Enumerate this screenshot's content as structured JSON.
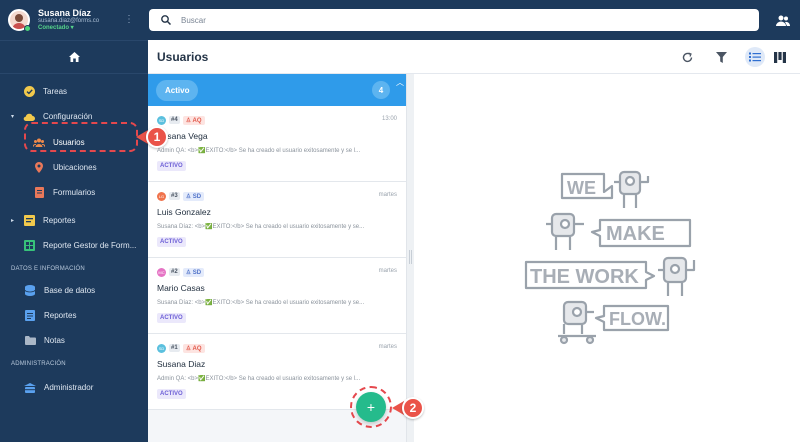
{
  "user": {
    "name": "Susana Díaz",
    "email": "susana.diaz@forms.co",
    "status": "Conectado"
  },
  "search": {
    "placeholder": "Buscar"
  },
  "sidebar": {
    "items": [
      {
        "label": "Tareas"
      },
      {
        "label": "Configuración"
      },
      {
        "label": "Usuarios"
      },
      {
        "label": "Ubicaciones"
      },
      {
        "label": "Formularios"
      },
      {
        "label": "Reportes"
      },
      {
        "label": "Reporte Gestor de Form..."
      }
    ],
    "section_data": "DATOS E INFORMACIÓN",
    "data_items": [
      {
        "label": "Base de datos"
      },
      {
        "label": "Reportes"
      },
      {
        "label": "Notas"
      }
    ],
    "section_admin": "ADMINISTRACIÓN",
    "admin_items": [
      {
        "label": "Administrador"
      }
    ]
  },
  "main": {
    "title": "Usuarios",
    "status_label": "Activo",
    "status_count": "4",
    "cards": [
      {
        "initials": "SD",
        "number": "#4",
        "assignee": "AQ",
        "time": "13:00",
        "name": "Susana Vega",
        "message": "Admin QA: <b>✅ÉXITO:</b> Se ha creado el usuario exitosamente y se l...",
        "badge": "ACTIVO"
      },
      {
        "initials": "LG",
        "number": "#3",
        "assignee": "SD",
        "time": "martes",
        "name": "Luis Gonzalez",
        "message": "Susana Díaz: <b>✅ÉXITO:</b> Se ha creado el usuario exitosamente y se...",
        "badge": "ACTIVO"
      },
      {
        "initials": "MC",
        "number": "#2",
        "assignee": "SD",
        "time": "martes",
        "name": "Mario Casas",
        "message": "Susana Díaz: <b>✅ÉXITO:</b> Se ha creado el usuario exitosamente y se...",
        "badge": "ACTIVO"
      },
      {
        "initials": "SD",
        "number": "#1",
        "assignee": "AQ",
        "time": "martes",
        "name": "Susana Diaz",
        "message": "Admin QA: <b>✅ÉXITO:</b> Se ha creado el usuario exitosamente y se l...",
        "badge": "ACTIVO"
      }
    ]
  },
  "illustration": {
    "line1": "WE",
    "line2": "MAKE",
    "line3": "THE WORK",
    "line4": "FLOW."
  },
  "callouts": {
    "one": "1",
    "two": "2"
  },
  "fab_label": "+",
  "colors": {
    "sidebar": "#1d3a5c",
    "accent": "#2f9bea",
    "fab": "#25bb8c",
    "callout": "#ea5349",
    "badge": "#6d5fd6"
  },
  "icons": [
    "home-icon",
    "check-circle-icon",
    "cloud-icon",
    "users-icon",
    "map-pin-icon",
    "form-icon",
    "report-icon",
    "database-icon",
    "notes-icon",
    "folder-icon",
    "admin-icon",
    "search-icon",
    "people-icon",
    "refresh-icon",
    "filter-icon",
    "list-view-icon",
    "board-view-icon"
  ]
}
